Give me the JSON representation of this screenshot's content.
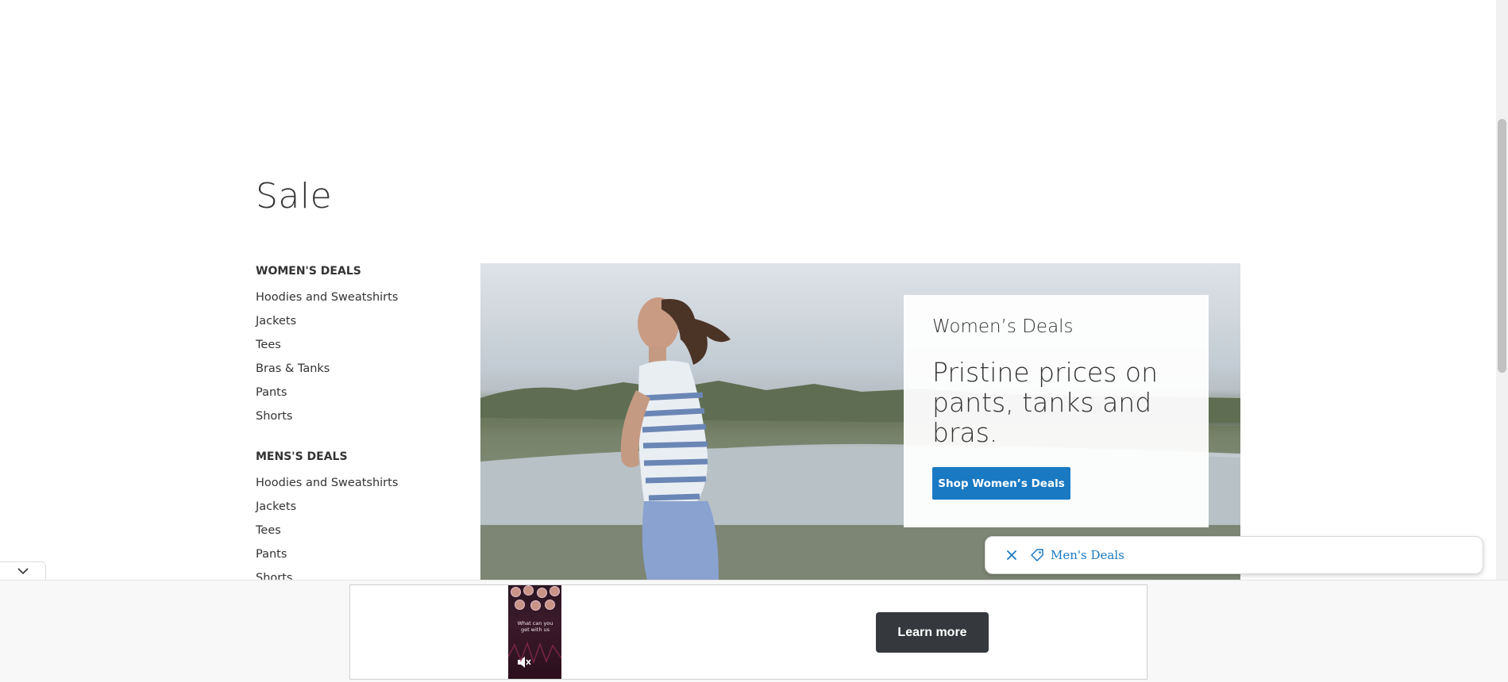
{
  "page": {
    "title": "Sale"
  },
  "sidebar": {
    "groups": [
      {
        "heading": "WOMEN'S DEALS",
        "items": [
          "Hoodies and Sweatshirts",
          "Jackets",
          "Tees",
          "Bras & Tanks",
          "Pants",
          "Shorts"
        ]
      },
      {
        "heading": "MENS'S DEALS",
        "items": [
          "Hoodies and Sweatshirts",
          "Jackets",
          "Tees",
          "Pants",
          "Shorts"
        ]
      }
    ]
  },
  "promo": {
    "eyebrow": "Women’s Deals",
    "headline": "Pristine prices on pants, tanks and bras.",
    "button_label": "Shop Women’s Deals"
  },
  "toast": {
    "close_icon": "close-icon",
    "tag_icon": "tag-icon",
    "link_label": "Men's Deals"
  },
  "ad": {
    "video_caption": "What can you get with us",
    "cta_label": "Learn more",
    "mute_icon": "muted-speaker-icon"
  },
  "colors": {
    "accent": "#1979c3",
    "cta_dark": "#35393d",
    "text": "#333333"
  }
}
